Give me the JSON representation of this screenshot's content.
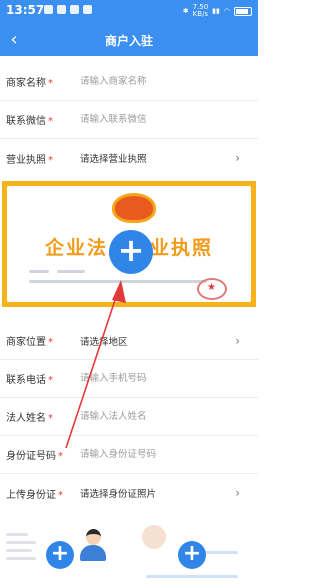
{
  "status_bar": {
    "time": "13:57",
    "network_speed": "7.50\nKB/s",
    "signal": "4G"
  },
  "navbar": {
    "back_icon": "chevron-left-icon",
    "title": "商户入驻"
  },
  "form": {
    "merchant_name": {
      "label": "商家名称",
      "required": "*",
      "placeholder": "请输入商家名称"
    },
    "contact_wechat": {
      "label": "联系微信",
      "required": "*",
      "placeholder": "请输入联系微信"
    },
    "business_license": {
      "label": "营业执照",
      "required": "*",
      "value": "请选择营业执照"
    },
    "merchant_location": {
      "label": "商家位置",
      "required": "*",
      "value": "请选择地区"
    },
    "contact_phone": {
      "label": "联系电话",
      "required": "*",
      "placeholder": "请输入手机号码"
    },
    "legal_name": {
      "label": "法人姓名",
      "required": "*",
      "placeholder": "请输入法人姓名"
    },
    "id_number": {
      "label": "身份证号码",
      "required": "*",
      "placeholder": "请输入身份证号码"
    },
    "upload_id": {
      "label": "上传身份证",
      "required": "*",
      "value": "请选择身份证照片"
    }
  },
  "license_card": {
    "title": "企业法人营业执照",
    "stamp": "★",
    "plus": "+"
  },
  "uploads": {
    "id_front_plus": "+",
    "id_back_plus": "+"
  },
  "colors": {
    "primary": "#3a8ff0",
    "accent_orange": "#f7b21c",
    "required_red": "#e23a3a"
  }
}
